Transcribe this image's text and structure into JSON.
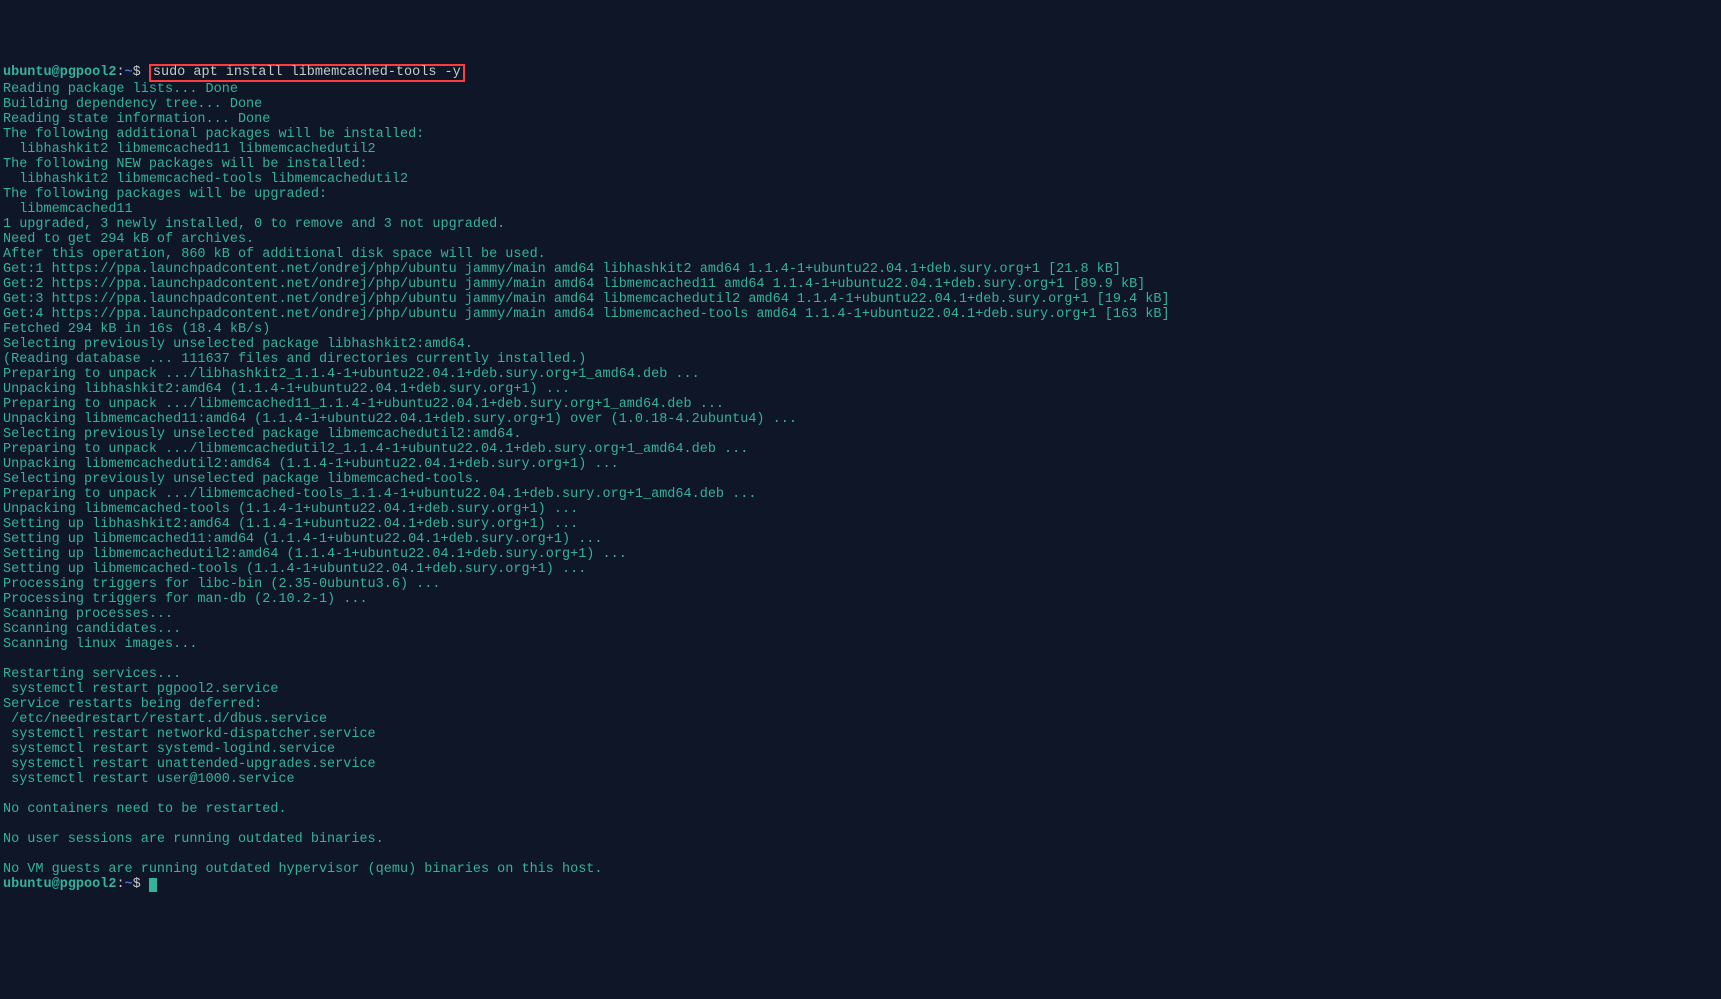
{
  "prompt": {
    "user": "ubuntu",
    "at": "@",
    "host": "pgpool2",
    "colon": ":",
    "path": "~",
    "dollar": "$"
  },
  "cmd1": "sudo apt install libmemcached-tools -y",
  "lines": [
    "Reading package lists... Done",
    "Building dependency tree... Done",
    "Reading state information... Done",
    "The following additional packages will be installed:",
    "  libhashkit2 libmemcached11 libmemcachedutil2",
    "The following NEW packages will be installed:",
    "  libhashkit2 libmemcached-tools libmemcachedutil2",
    "The following packages will be upgraded:",
    "  libmemcached11",
    "1 upgraded, 3 newly installed, 0 to remove and 3 not upgraded.",
    "Need to get 294 kB of archives.",
    "After this operation, 860 kB of additional disk space will be used.",
    "Get:1 https://ppa.launchpadcontent.net/ondrej/php/ubuntu jammy/main amd64 libhashkit2 amd64 1.1.4-1+ubuntu22.04.1+deb.sury.org+1 [21.8 kB]",
    "Get:2 https://ppa.launchpadcontent.net/ondrej/php/ubuntu jammy/main amd64 libmemcached11 amd64 1.1.4-1+ubuntu22.04.1+deb.sury.org+1 [89.9 kB]",
    "Get:3 https://ppa.launchpadcontent.net/ondrej/php/ubuntu jammy/main amd64 libmemcachedutil2 amd64 1.1.4-1+ubuntu22.04.1+deb.sury.org+1 [19.4 kB]",
    "Get:4 https://ppa.launchpadcontent.net/ondrej/php/ubuntu jammy/main amd64 libmemcached-tools amd64 1.1.4-1+ubuntu22.04.1+deb.sury.org+1 [163 kB]",
    "Fetched 294 kB in 16s (18.4 kB/s)",
    "Selecting previously unselected package libhashkit2:amd64.",
    "(Reading database ... 111637 files and directories currently installed.)",
    "Preparing to unpack .../libhashkit2_1.1.4-1+ubuntu22.04.1+deb.sury.org+1_amd64.deb ...",
    "Unpacking libhashkit2:amd64 (1.1.4-1+ubuntu22.04.1+deb.sury.org+1) ...",
    "Preparing to unpack .../libmemcached11_1.1.4-1+ubuntu22.04.1+deb.sury.org+1_amd64.deb ...",
    "Unpacking libmemcached11:amd64 (1.1.4-1+ubuntu22.04.1+deb.sury.org+1) over (1.0.18-4.2ubuntu4) ...",
    "Selecting previously unselected package libmemcachedutil2:amd64.",
    "Preparing to unpack .../libmemcachedutil2_1.1.4-1+ubuntu22.04.1+deb.sury.org+1_amd64.deb ...",
    "Unpacking libmemcachedutil2:amd64 (1.1.4-1+ubuntu22.04.1+deb.sury.org+1) ...",
    "Selecting previously unselected package libmemcached-tools.",
    "Preparing to unpack .../libmemcached-tools_1.1.4-1+ubuntu22.04.1+deb.sury.org+1_amd64.deb ...",
    "Unpacking libmemcached-tools (1.1.4-1+ubuntu22.04.1+deb.sury.org+1) ...",
    "Setting up libhashkit2:amd64 (1.1.4-1+ubuntu22.04.1+deb.sury.org+1) ...",
    "Setting up libmemcached11:amd64 (1.1.4-1+ubuntu22.04.1+deb.sury.org+1) ...",
    "Setting up libmemcachedutil2:amd64 (1.1.4-1+ubuntu22.04.1+deb.sury.org+1) ...",
    "Setting up libmemcached-tools (1.1.4-1+ubuntu22.04.1+deb.sury.org+1) ...",
    "Processing triggers for libc-bin (2.35-0ubuntu3.6) ...",
    "Processing triggers for man-db (2.10.2-1) ...",
    "Scanning processes...",
    "Scanning candidates...",
    "Scanning linux images...",
    "",
    "Restarting services...",
    " systemctl restart pgpool2.service",
    "Service restarts being deferred:",
    " /etc/needrestart/restart.d/dbus.service",
    " systemctl restart networkd-dispatcher.service",
    " systemctl restart systemd-logind.service",
    " systemctl restart unattended-upgrades.service",
    " systemctl restart user@1000.service",
    "",
    "No containers need to be restarted.",
    "",
    "No user sessions are running outdated binaries.",
    "",
    "No VM guests are running outdated hypervisor (qemu) binaries on this host."
  ]
}
